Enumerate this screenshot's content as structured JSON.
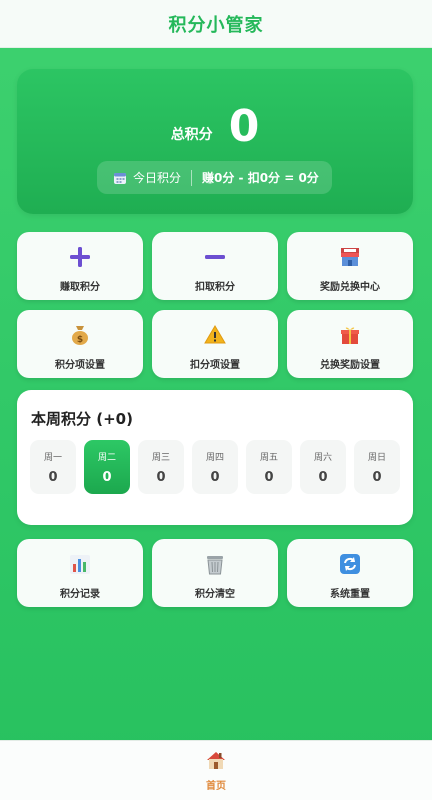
{
  "header": {
    "title": "积分小管家"
  },
  "summary": {
    "total_label": "总积分",
    "total_value": "0",
    "today_label": "今日积分",
    "today_formula": "赚0分 - 扣0分 = 0分",
    "calendar_icon": "calendar-icon"
  },
  "actions": [
    {
      "label": "赚取积分",
      "icon": "plus-icon",
      "color": "#6c4fd1"
    },
    {
      "label": "扣取积分",
      "icon": "minus-icon",
      "color": "#6c4fd1"
    },
    {
      "label": "奖励兑换中心",
      "icon": "store-icon"
    },
    {
      "label": "积分项设置",
      "icon": "money-bag-icon"
    },
    {
      "label": "扣分项设置",
      "icon": "warning-icon"
    },
    {
      "label": "兑换奖励设置",
      "icon": "gift-icon"
    }
  ],
  "week": {
    "title": "本周积分 (+0)",
    "days": [
      {
        "name": "周一",
        "value": "0"
      },
      {
        "name": "周二",
        "value": "0",
        "active": true
      },
      {
        "name": "周三",
        "value": "0"
      },
      {
        "name": "周四",
        "value": "0"
      },
      {
        "name": "周五",
        "value": "0"
      },
      {
        "name": "周六",
        "value": "0"
      },
      {
        "name": "周日",
        "value": "0"
      }
    ]
  },
  "tools": [
    {
      "label": "积分记录",
      "icon": "bar-chart-icon"
    },
    {
      "label": "积分清空",
      "icon": "trash-icon"
    },
    {
      "label": "系统重置",
      "icon": "refresh-icon"
    }
  ],
  "nav": {
    "home_label": "首页",
    "home_icon": "home-icon"
  },
  "colors": {
    "accent": "#25b85a",
    "active_nav": "#e08a3c"
  }
}
